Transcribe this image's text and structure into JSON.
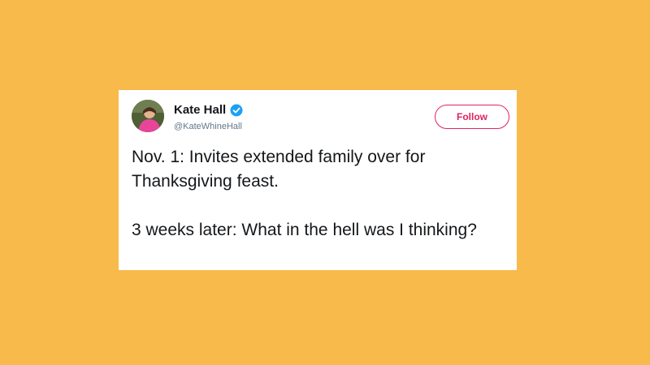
{
  "background_color": "#f7ba4b",
  "tweet": {
    "display_name": "Kate Hall",
    "verified": true,
    "handle": "@KateWhineHall",
    "follow_label": "Follow",
    "accent_color": "#e0245e",
    "verified_color": "#1da1f2",
    "text": "Nov. 1: Invites extended family over for Thanksgiving feast.\n\n3 weeks later: What in the hell was I thinking?"
  }
}
